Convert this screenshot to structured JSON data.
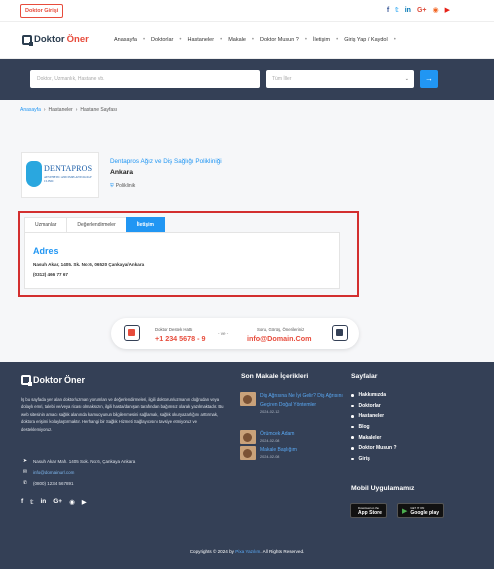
{
  "topbar": {
    "login_label": "Doktor Girişi",
    "social": [
      {
        "icon": "facebook-icon",
        "glyph": "f",
        "color": "#3b5998"
      },
      {
        "icon": "twitter-icon",
        "glyph": "𝕥",
        "color": "#1da1f2"
      },
      {
        "icon": "linkedin-icon",
        "glyph": "in",
        "color": "#0077b5"
      },
      {
        "icon": "google-plus-icon",
        "glyph": "G+",
        "color": "#dd4b39"
      },
      {
        "icon": "rss-icon",
        "glyph": "◉",
        "color": "#f26522"
      },
      {
        "icon": "youtube-icon",
        "glyph": "▶",
        "color": "#e62117"
      }
    ]
  },
  "brand": {
    "part1": "Doktor",
    "part2": "Öner"
  },
  "nav": {
    "items": [
      "Anasayfa",
      "Doktorlar",
      "Hastaneler",
      "Makale",
      "Doktor Musun ?",
      "İletişim",
      "Giriş Yap / Kaydol"
    ]
  },
  "search": {
    "placeholder": "Doktor, Uzmanlık, Hastane vb.",
    "select_value": "Tüm İller",
    "button_icon": "arrow-right-icon"
  },
  "breadcrumb": {
    "items": [
      "Anasayfa",
      "Hastaneler",
      "Hastane Sayfası"
    ]
  },
  "clinic": {
    "logo_name": "DENTAPROS",
    "logo_sub": "AESTHETIC AND IMPLANTOLOGY CLINIC",
    "title": "Dentapros Ağız ve Diş Sağlığı Polikliniği",
    "city": "Ankara",
    "type": "Poliklinik"
  },
  "tabs": {
    "items": [
      "Uzmanlar",
      "Değerlendirmeler",
      "İletişim"
    ],
    "active_index": 2
  },
  "contact": {
    "heading": "Adres",
    "address": "Nasuh Akar, 1405. Sk. No:6, 06520 Çankaya/Ankara",
    "phone": "(0312) 466 77 67"
  },
  "support": {
    "line_label": "Doktor Destek Hattı",
    "phone": "+1 234 5678 - 9",
    "or": "- ve -",
    "mail_label": "Soru, Görüş, Önerileriniz",
    "email": "info@Domain.Com"
  },
  "footer": {
    "description": "İş bu sayfada yer alan doktor/uzman yorumları ve değerlendirmeleri, ilgili doktorun/uzmanın doğrudan veya dolaylı emri, talebi ve/veya ricası olmaksızın, ilgili hasta/danışan tarafından bağımsız olarak yazılmaktadır. Bu web sitesinin amacı sağlık alanında kamuoyunun bilgilenmesini sağlamak, sağlık okuryazarlığını arttırmak, doktora erişimi kolaylaştırmaktır. Herhangi bir Sağlık Hizmeti Sağlayıcısını tavsiye etmiyoruz ve desteklemiyoruz.",
    "address": "Nasuh Akar Mah. 1405 Sok. No:6, Çankaya Ankara",
    "email": "info@domainurl.com",
    "phone": "(0800) 1234 567891",
    "articles_heading": "Son Makale İçerikleri",
    "articles": [
      {
        "title": "Diş Ağrısına Ne İyi Gelir? Diş Ağrısını Geçiren Doğal Yöntemler",
        "date": "2024-02-12"
      },
      {
        "title": "Örümcek Adam",
        "date": "2024-02-08"
      },
      {
        "title": "Makale Başlığım",
        "date": "2024-02-08"
      }
    ],
    "pages_heading": "Sayfalar",
    "pages": [
      "Hakkımızda",
      "Doktorlar",
      "Hastaneler",
      "Blog",
      "Makaleler",
      "Doktor Musun ?",
      "Giriş"
    ],
    "apps_heading": "Mobil Uygulamamız",
    "appstore_small": "Download on the",
    "appstore": "App Store",
    "googleplay_small": "GET IT ON",
    "googleplay": "Google play",
    "copyright_pre": "Copyrights © 2024 by",
    "copyright_brand": "Pixa Yazılım",
    "copyright_post": ". All Rights Reserved."
  }
}
